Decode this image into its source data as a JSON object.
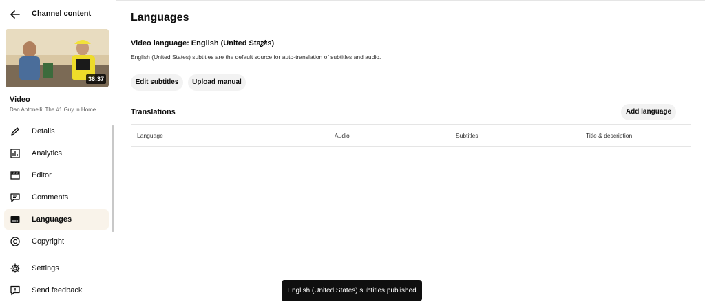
{
  "sidebar": {
    "back_label": "Channel content",
    "thumbnail": {
      "duration": "36:37"
    },
    "video_label": "Video",
    "video_title": "Dan Antonelli: The #1 Guy in Home ...",
    "nav": [
      {
        "id": "details",
        "label": "Details",
        "icon": "pencil-icon",
        "active": false
      },
      {
        "id": "analytics",
        "label": "Analytics",
        "icon": "analytics-icon",
        "active": false
      },
      {
        "id": "editor",
        "label": "Editor",
        "icon": "clapperboard-icon",
        "active": false
      },
      {
        "id": "comments",
        "label": "Comments",
        "icon": "comment-icon",
        "active": false
      },
      {
        "id": "languages",
        "label": "Languages",
        "icon": "subtitles-icon",
        "active": true
      },
      {
        "id": "copyright",
        "label": "Copyright",
        "icon": "copyright-icon",
        "active": false
      }
    ],
    "footer": [
      {
        "id": "settings",
        "label": "Settings",
        "icon": "gear-icon"
      },
      {
        "id": "feedback",
        "label": "Send feedback",
        "icon": "feedback-icon"
      }
    ]
  },
  "main": {
    "title": "Languages",
    "video_language": "Video language: English (United States)",
    "description": "English (United States) subtitles are the default source for auto-translation of subtitles and audio.",
    "buttons": {
      "edit_subtitles": "Edit subtitles",
      "upload_manual": "Upload manual",
      "add_language": "Add language"
    },
    "translations_heading": "Translations",
    "table_headers": [
      "Language",
      "Audio",
      "Subtitles",
      "Title & description"
    ]
  },
  "toast": "English (United States) subtitles published",
  "colors": {
    "active_bg": "#f9f3ea",
    "chip_bg": "#f2f2f2",
    "toast_bg": "#0f0f0f"
  }
}
